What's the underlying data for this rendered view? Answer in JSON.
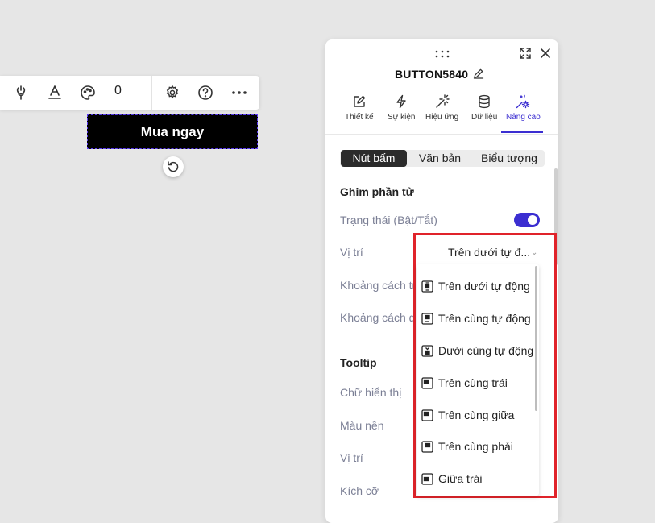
{
  "toolbar": {
    "count": "0",
    "icons": [
      "link-icon",
      "text-format-icon",
      "palette-icon",
      "gear-icon",
      "help-icon",
      "more-icon"
    ]
  },
  "canvas": {
    "button_label": "Mua ngay"
  },
  "panel": {
    "title": "BUTTON5840",
    "tabs": [
      {
        "label": "Thiết kế",
        "icon": "pencil-square-icon"
      },
      {
        "label": "Sự kiện",
        "icon": "bolt-icon"
      },
      {
        "label": "Hiệu ứng",
        "icon": "magic-wand-icon"
      },
      {
        "label": "Dữ liệu",
        "icon": "database-icon"
      },
      {
        "label": "Nâng cao",
        "icon": "advanced-settings-icon"
      }
    ],
    "active_tab": "Nâng cao",
    "segments": [
      "Nút bấm",
      "Văn bản",
      "Biểu tượng"
    ],
    "active_segment": "Nút bấm",
    "pin_section": {
      "title": "Ghim phần tử",
      "status_label": "Trạng thái (Bật/Tắt)",
      "status_on": true,
      "position_label": "Vị trí",
      "position_value": "Trên dưới tự đ...",
      "distance_top_label": "Khoảng cách tr",
      "distance_bottom_label": "Khoảng cách d"
    },
    "tooltip_section": {
      "title": "Tooltip",
      "text_label": "Chữ hiển thị",
      "bg_label": "Màu nền",
      "position_label": "Vị trí",
      "size_label": "Kích cỡ"
    }
  },
  "dropdown": {
    "options": [
      "Trên dưới tự động",
      "Trên cùng tự động",
      "Dưới cùng tự động",
      "Trên cùng trái",
      "Trên cùng giữa",
      "Trên cùng phải",
      "Giữa trái"
    ]
  },
  "colors": {
    "accent": "#3b2ed1",
    "highlight_border": "#e0232a",
    "canvas_button_bg": "#000000",
    "selection_outline": "#5b3cf5"
  }
}
